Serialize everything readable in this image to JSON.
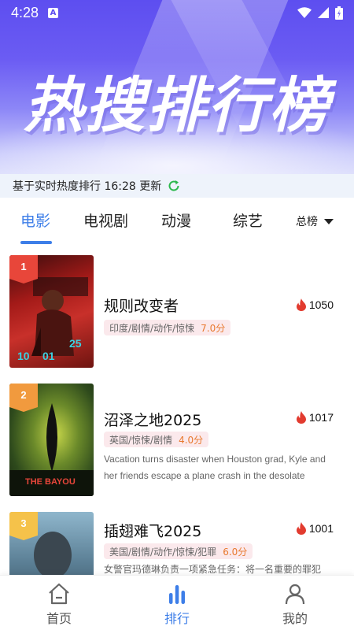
{
  "status_bar": {
    "time": "4:28",
    "badge": "A"
  },
  "hero": {
    "title": "热搜排行榜"
  },
  "update_bar": {
    "text": "基于实时热度排行 16:28 更新"
  },
  "tabs": [
    {
      "label": "电影",
      "active": true
    },
    {
      "label": "电视剧",
      "active": false
    },
    {
      "label": "动漫",
      "active": false
    },
    {
      "label": "综艺",
      "active": false
    }
  ],
  "sort_dropdown": {
    "selected": "总榜"
  },
  "items": [
    {
      "rank": "1",
      "title": "规则改变者",
      "heat": "1050",
      "tags": "印度/剧情/动作/惊悚",
      "score": "7.0分",
      "description": ""
    },
    {
      "rank": "2",
      "title": "沼泽之地2025",
      "heat": "1017",
      "tags": "英国/惊悚/剧情",
      "score": "4.0分",
      "description": "Vacation turns disaster when Houston grad, Kyle and her friends escape a plane crash in the desolate"
    },
    {
      "rank": "3",
      "title": "插翅难飞2025",
      "heat": "1001",
      "tags": "美国/剧情/动作/惊悚/犯罪",
      "score": "6.0分",
      "description": "女警官玛德琳负责一项紧急任务：将一名重要的罪犯"
    }
  ],
  "bottom_nav": [
    {
      "label": "首页",
      "icon": "home-icon",
      "active": false
    },
    {
      "label": "排行",
      "icon": "ranking-icon",
      "active": true
    },
    {
      "label": "我的",
      "icon": "profile-icon",
      "active": false
    }
  ],
  "colors": {
    "accent": "#3d7ee8",
    "rank1": "#e8463a",
    "rank2": "#f19a3e",
    "rank3": "#f5c24a",
    "heat": "#e23b2f",
    "score": "#e8792e",
    "refresh": "#2db84d"
  }
}
